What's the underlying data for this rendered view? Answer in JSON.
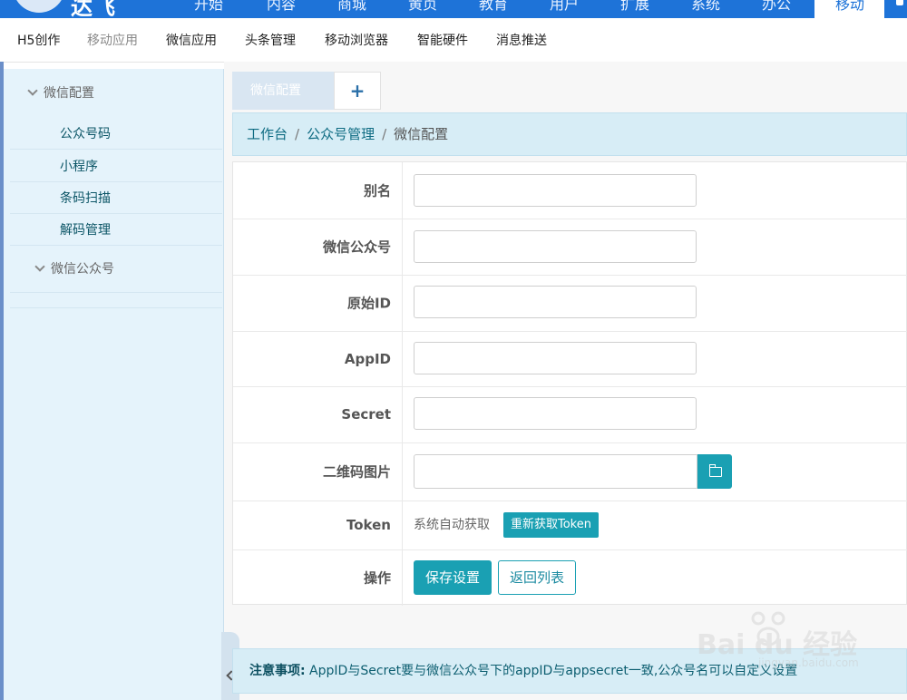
{
  "topnav": {
    "logo_text": "达飞",
    "items": [
      "开始",
      "内容",
      "商城",
      "黄页",
      "教育",
      "用户",
      "扩展",
      "系统",
      "办公",
      "移动"
    ],
    "active_index": 9
  },
  "submenu": {
    "items": [
      "H5创作",
      "移动应用",
      "微信应用",
      "头条管理",
      "移动浏览器",
      "智能硬件",
      "消息推送"
    ],
    "muted_index": 1
  },
  "sidebar": {
    "group1": "微信配置",
    "items": [
      "公众号码",
      "小程序",
      "条码扫描",
      "解码管理"
    ],
    "group2": "微信公众号"
  },
  "tabs": {
    "active_label": "微信配置",
    "add_label": "+"
  },
  "breadcrumb": {
    "level1": "工作台",
    "level2": "公众号管理",
    "current": "微信配置",
    "separator": "/"
  },
  "form": {
    "alias_label": "别名",
    "alias_value": "",
    "account_label": "微信公众号",
    "account_value": "",
    "origin_id_label": "原始ID",
    "origin_id_value": "",
    "appid_label": "AppID",
    "appid_value": "",
    "secret_label": "Secret",
    "secret_value": "",
    "qrcode_label": "二维码图片",
    "qrcode_value": "",
    "token_label": "Token",
    "token_text": "系统自动获取",
    "token_button": "重新获取Token",
    "action_label": "操作",
    "save_button": "保存设置",
    "back_button": "返回列表"
  },
  "notice": {
    "title": "注意事项:",
    "text": " AppID与Secret要与微信公众号下的appID与appsecret一致,公众号名可以自定义设置"
  },
  "watermark": {
    "text": "Bai du 经验",
    "sub": "jingyan.baidu.com"
  },
  "colors": {
    "nav_blue": "#1e73d8",
    "accent_teal": "#1aa0b3",
    "sidebar_bg": "#e5f3fb",
    "breadcrumb_bg": "#d7edf6"
  }
}
